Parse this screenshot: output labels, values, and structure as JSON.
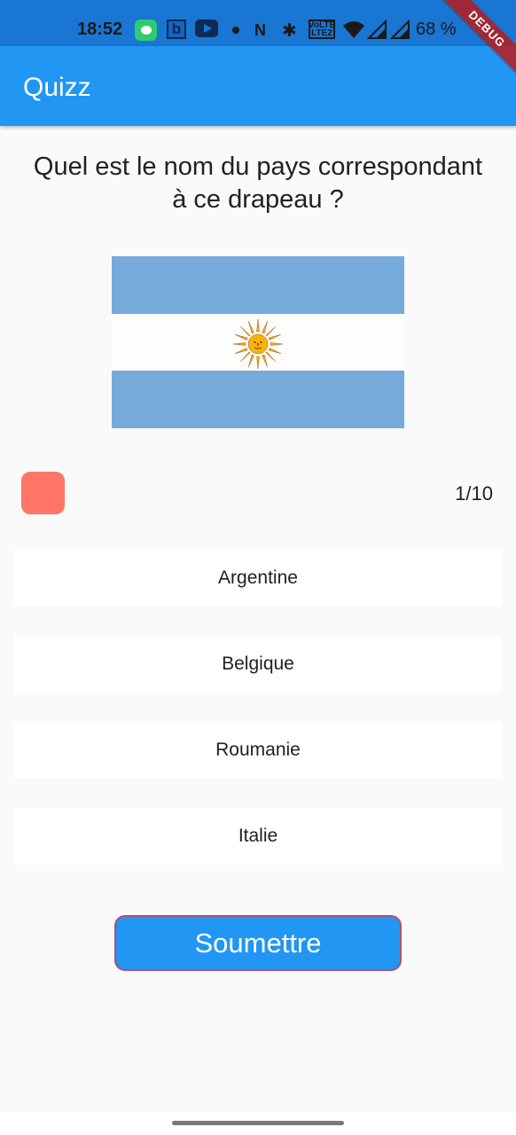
{
  "status_bar": {
    "time": "18:52",
    "battery": "68 %",
    "icons": [
      "messages-icon",
      "b-app-icon",
      "youtube-icon",
      "dot-icon",
      "nfc-icon",
      "bluetooth-icon",
      "volte-icon",
      "wifi-icon",
      "signal-icon",
      "signal-icon"
    ],
    "b_label": "b",
    "nfc_label": "N",
    "bt_label": "✱",
    "lte_label_top": "VoLTE",
    "lte_label_bottom": "LTE2"
  },
  "debug_banner": "DEBUG",
  "app_bar": {
    "title": "Quizz"
  },
  "question": "Quel est le nom du pays correspondant à ce drapeau ?",
  "flag": {
    "country_flag": "argentina-flag",
    "colors": {
      "stripe": "#75aadb",
      "middle": "#fdfdfb",
      "sun": "#f6b40e"
    }
  },
  "progress": {
    "text": "1/10",
    "score_color": "#ff7567"
  },
  "answers": [
    {
      "label": "Argentine"
    },
    {
      "label": "Belgique"
    },
    {
      "label": "Roumanie"
    },
    {
      "label": "Italie"
    }
  ],
  "submit": {
    "label": "Soumettre"
  },
  "colors": {
    "primary": "#2196f3",
    "status_bar": "#1976d2",
    "background": "#fafafa"
  }
}
